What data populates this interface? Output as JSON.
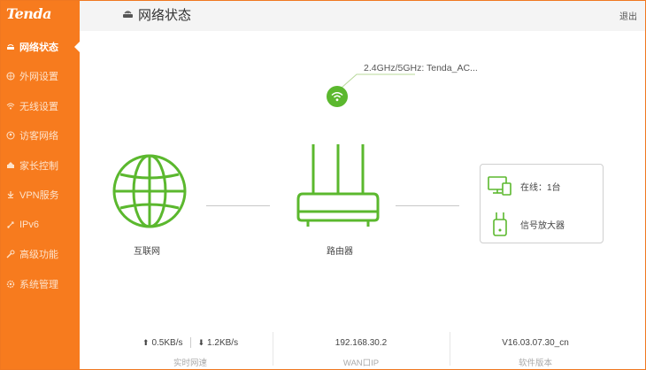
{
  "brand": {
    "logo_text": "Tenda",
    "accent_color": "#f77b1e",
    "online_color": "#5bb82e"
  },
  "sidebar": {
    "items": [
      {
        "label": "网络状态",
        "icon": "status-icon",
        "active": true
      },
      {
        "label": "外网设置",
        "icon": "globe-icon"
      },
      {
        "label": "无线设置",
        "icon": "wifi-icon"
      },
      {
        "label": "访客网络",
        "icon": "guest-icon"
      },
      {
        "label": "家长控制",
        "icon": "parental-icon"
      },
      {
        "label": "VPN服务",
        "icon": "vpn-icon"
      },
      {
        "label": "IPv6",
        "icon": "ipv6-icon"
      },
      {
        "label": "高级功能",
        "icon": "tools-icon"
      },
      {
        "label": "系统管理",
        "icon": "gear-icon"
      }
    ]
  },
  "header": {
    "title": "网络状态",
    "logout_label": "退出"
  },
  "topology": {
    "wifi_label": "2.4GHz/5GHz: Tenda_AC...",
    "internet_label": "互联网",
    "router_label": "路由器",
    "online_label": "在线：1台",
    "extender_label": "信号放大器"
  },
  "stats": {
    "upload": "0.5KB/s",
    "download": "1.2KB/s",
    "speed_label": "实时网速",
    "wan_ip": "192.168.30.2",
    "wan_ip_label": "WAN口IP",
    "firmware": "V16.03.07.30_cn",
    "firmware_label": "软件版本"
  }
}
